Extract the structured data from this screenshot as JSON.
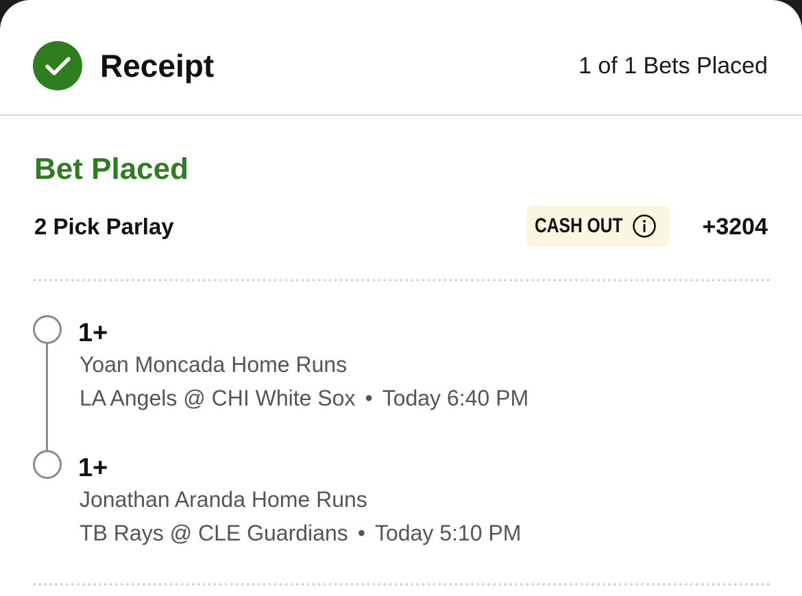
{
  "header": {
    "title": "Receipt",
    "bets_placed": "1 of 1 Bets Placed"
  },
  "bet": {
    "status": "Bet Placed",
    "parlay_title": "2 Pick Parlay",
    "cash_out_label": "CASH OUT",
    "odds": "+3204",
    "legs": [
      {
        "selection": "1+",
        "market": "Yoan Moncada Home Runs",
        "matchup": "LA Angels @ CHI White Sox",
        "separator": "•",
        "time": "Today 6:40 PM"
      },
      {
        "selection": "1+",
        "market": "Jonathan Aranda Home Runs",
        "matchup": "TB Rays @ CLE Guardians",
        "separator": "•",
        "time": "Today 5:10 PM"
      }
    ]
  },
  "colors": {
    "success_green": "#2e7d1f",
    "badge_bg": "#fbf6df",
    "timeline_gray": "#8a8a8a"
  },
  "icons": {
    "status": "check-circle-icon",
    "cash_out_info": "info-icon"
  }
}
